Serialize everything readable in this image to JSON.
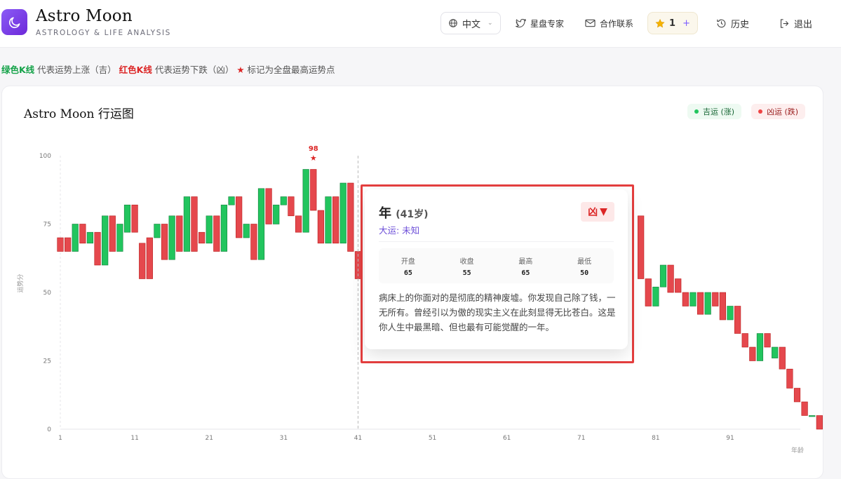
{
  "header": {
    "brand_title": "Astro Moon",
    "brand_subtitle": "ASTROLOGY & LIFE ANALYSIS",
    "language": "中文",
    "expert_label": "星盘专家",
    "contact_label": "合作联系",
    "credits": "1",
    "credits_plus": "+",
    "history_label": "历史",
    "logout_label": "退出"
  },
  "legend": {
    "green_label": "绿色K线",
    "green_desc": "代表运势上涨（吉）",
    "red_label": "红色K线",
    "red_desc": "代表运势下跌（凶）",
    "star_symbol": "★",
    "star_desc": "标记为全盘最高运势点"
  },
  "card": {
    "title": "Astro Moon 行运图",
    "up_pill": "吉运 (涨)",
    "down_pill": "凶运 (跌)"
  },
  "tooltip": {
    "year_label": "年",
    "age": "(41岁)",
    "badge": "凶",
    "badge_arrow": "▼",
    "dayun": "大运: 未知",
    "open_label": "开盘",
    "open": "65",
    "close_label": "收盘",
    "close": "55",
    "high_label": "最高",
    "high": "65",
    "low_label": "最低",
    "low": "50",
    "text": "病床上的你面对的是彻底的精神废墟。你发现自己除了钱，一无所有。曾经引以为傲的现实主义在此刻显得无比苍白。这是你人生中最黑暗、但也最有可能觉醒的一年。"
  },
  "colors": {
    "up": "#22c55e",
    "down": "#e5484d",
    "accent": "#7c3aed",
    "highlight": "#e53e3e"
  },
  "icons": {
    "logo": "moon-icon",
    "language": "globe-icon",
    "expert": "twitter-bird-icon",
    "contact": "mail-icon",
    "credits": "star-icon",
    "history": "history-icon",
    "logout": "logout-icon"
  },
  "chart_data": {
    "type": "candlestick",
    "ylabel": "运势分",
    "xlabel": "年龄",
    "ylim": [
      0,
      100
    ],
    "xlim": [
      1,
      100
    ],
    "yticks": [
      0,
      25,
      50,
      75,
      100
    ],
    "xticks": [
      1,
      11,
      21,
      31,
      41,
      51,
      61,
      71,
      81,
      91
    ],
    "peak": {
      "age": 35,
      "value": 98,
      "label": "98",
      "symbol": "★"
    },
    "hover_age": 41,
    "grid": false,
    "candles": [
      {
        "age": 1,
        "open": 70,
        "close": 65
      },
      {
        "age": 2,
        "open": 70,
        "close": 65
      },
      {
        "age": 3,
        "open": 65,
        "close": 75
      },
      {
        "age": 4,
        "open": 75,
        "close": 68
      },
      {
        "age": 5,
        "open": 68,
        "close": 72
      },
      {
        "age": 6,
        "open": 72,
        "close": 60
      },
      {
        "age": 7,
        "open": 60,
        "close": 78
      },
      {
        "age": 8,
        "open": 78,
        "close": 65
      },
      {
        "age": 9,
        "open": 65,
        "close": 75
      },
      {
        "age": 10,
        "open": 72,
        "close": 82
      },
      {
        "age": 11,
        "open": 82,
        "close": 72
      },
      {
        "age": 12,
        "open": 68,
        "close": 55
      },
      {
        "age": 13,
        "open": 70,
        "close": 55
      },
      {
        "age": 14,
        "open": 70,
        "close": 75
      },
      {
        "age": 15,
        "open": 75,
        "close": 62
      },
      {
        "age": 16,
        "open": 62,
        "close": 78
      },
      {
        "age": 17,
        "open": 78,
        "close": 65
      },
      {
        "age": 18,
        "open": 65,
        "close": 85
      },
      {
        "age": 19,
        "open": 85,
        "close": 65
      },
      {
        "age": 20,
        "open": 72,
        "close": 68
      },
      {
        "age": 21,
        "open": 68,
        "close": 78
      },
      {
        "age": 22,
        "open": 78,
        "close": 65
      },
      {
        "age": 23,
        "open": 65,
        "close": 82
      },
      {
        "age": 24,
        "open": 82,
        "close": 85
      },
      {
        "age": 25,
        "open": 85,
        "close": 70
      },
      {
        "age": 26,
        "open": 70,
        "close": 75
      },
      {
        "age": 27,
        "open": 75,
        "close": 62
      },
      {
        "age": 28,
        "open": 62,
        "close": 88
      },
      {
        "age": 29,
        "open": 88,
        "close": 75
      },
      {
        "age": 30,
        "open": 75,
        "close": 82
      },
      {
        "age": 31,
        "open": 82,
        "close": 85
      },
      {
        "age": 32,
        "open": 85,
        "close": 78
      },
      {
        "age": 33,
        "open": 78,
        "close": 72
      },
      {
        "age": 34,
        "open": 72,
        "close": 95
      },
      {
        "age": 35,
        "open": 95,
        "close": 80
      },
      {
        "age": 36,
        "open": 80,
        "close": 68
      },
      {
        "age": 37,
        "open": 68,
        "close": 85
      },
      {
        "age": 38,
        "open": 85,
        "close": 68
      },
      {
        "age": 39,
        "open": 68,
        "close": 90
      },
      {
        "age": 40,
        "open": 90,
        "close": 65
      },
      {
        "age": 41,
        "open": 65,
        "close": 55
      },
      {
        "age": 79,
        "open": 78,
        "close": 55
      },
      {
        "age": 80,
        "open": 55,
        "close": 45
      },
      {
        "age": 81,
        "open": 45,
        "close": 52
      },
      {
        "age": 82,
        "open": 52,
        "close": 60
      },
      {
        "age": 83,
        "open": 60,
        "close": 50
      },
      {
        "age": 84,
        "open": 55,
        "close": 50
      },
      {
        "age": 85,
        "open": 50,
        "close": 45
      },
      {
        "age": 86,
        "open": 45,
        "close": 50
      },
      {
        "age": 87,
        "open": 50,
        "close": 42
      },
      {
        "age": 88,
        "open": 42,
        "close": 50
      },
      {
        "age": 89,
        "open": 50,
        "close": 45
      },
      {
        "age": 90,
        "open": 50,
        "close": 40
      },
      {
        "age": 91,
        "open": 40,
        "close": 45
      },
      {
        "age": 92,
        "open": 45,
        "close": 35
      },
      {
        "age": 93,
        "open": 35,
        "close": 30
      },
      {
        "age": 94,
        "open": 30,
        "close": 25
      },
      {
        "age": 95,
        "open": 25,
        "close": 35
      },
      {
        "age": 96,
        "open": 35,
        "close": 30
      },
      {
        "age": 97,
        "open": 26,
        "close": 30
      },
      {
        "age": 98,
        "open": 30,
        "close": 22
      },
      {
        "age": 99,
        "open": 22,
        "close": 15
      },
      {
        "age": 100,
        "open": 15,
        "close": 10
      },
      {
        "age": 101,
        "open": 10,
        "close": 5
      },
      {
        "age": 102,
        "open": 5,
        "close": 5
      },
      {
        "age": 103,
        "open": 5,
        "close": 0
      }
    ]
  }
}
